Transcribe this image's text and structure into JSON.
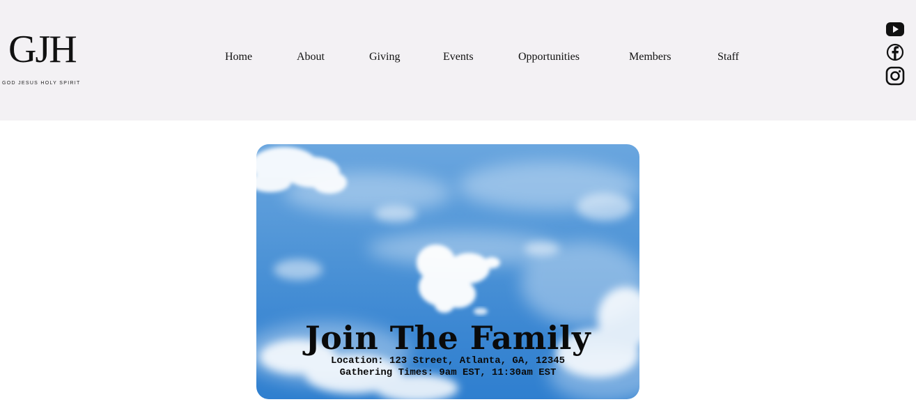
{
  "logo": {
    "mark": "GJH",
    "tagline": "GOD JESUS HOLY SPIRIT"
  },
  "nav": {
    "items": [
      {
        "label": "Home"
      },
      {
        "label": "About"
      },
      {
        "label": "Giving"
      },
      {
        "label": "Events"
      },
      {
        "label": "Opportunities"
      },
      {
        "label": "Members"
      },
      {
        "label": "Staff"
      }
    ]
  },
  "social": {
    "icons": [
      "youtube-icon",
      "facebook-icon",
      "instagram-icon"
    ]
  },
  "hero": {
    "title": "Join The Family",
    "location": "Location: 123 Street, Atlanta, GA, 12345",
    "times": "Gathering Times: 9am EST, 11:30am EST"
  },
  "colors": {
    "header_bg": "#f3f1f4",
    "sky": "#4d93d6",
    "text": "#111111"
  }
}
